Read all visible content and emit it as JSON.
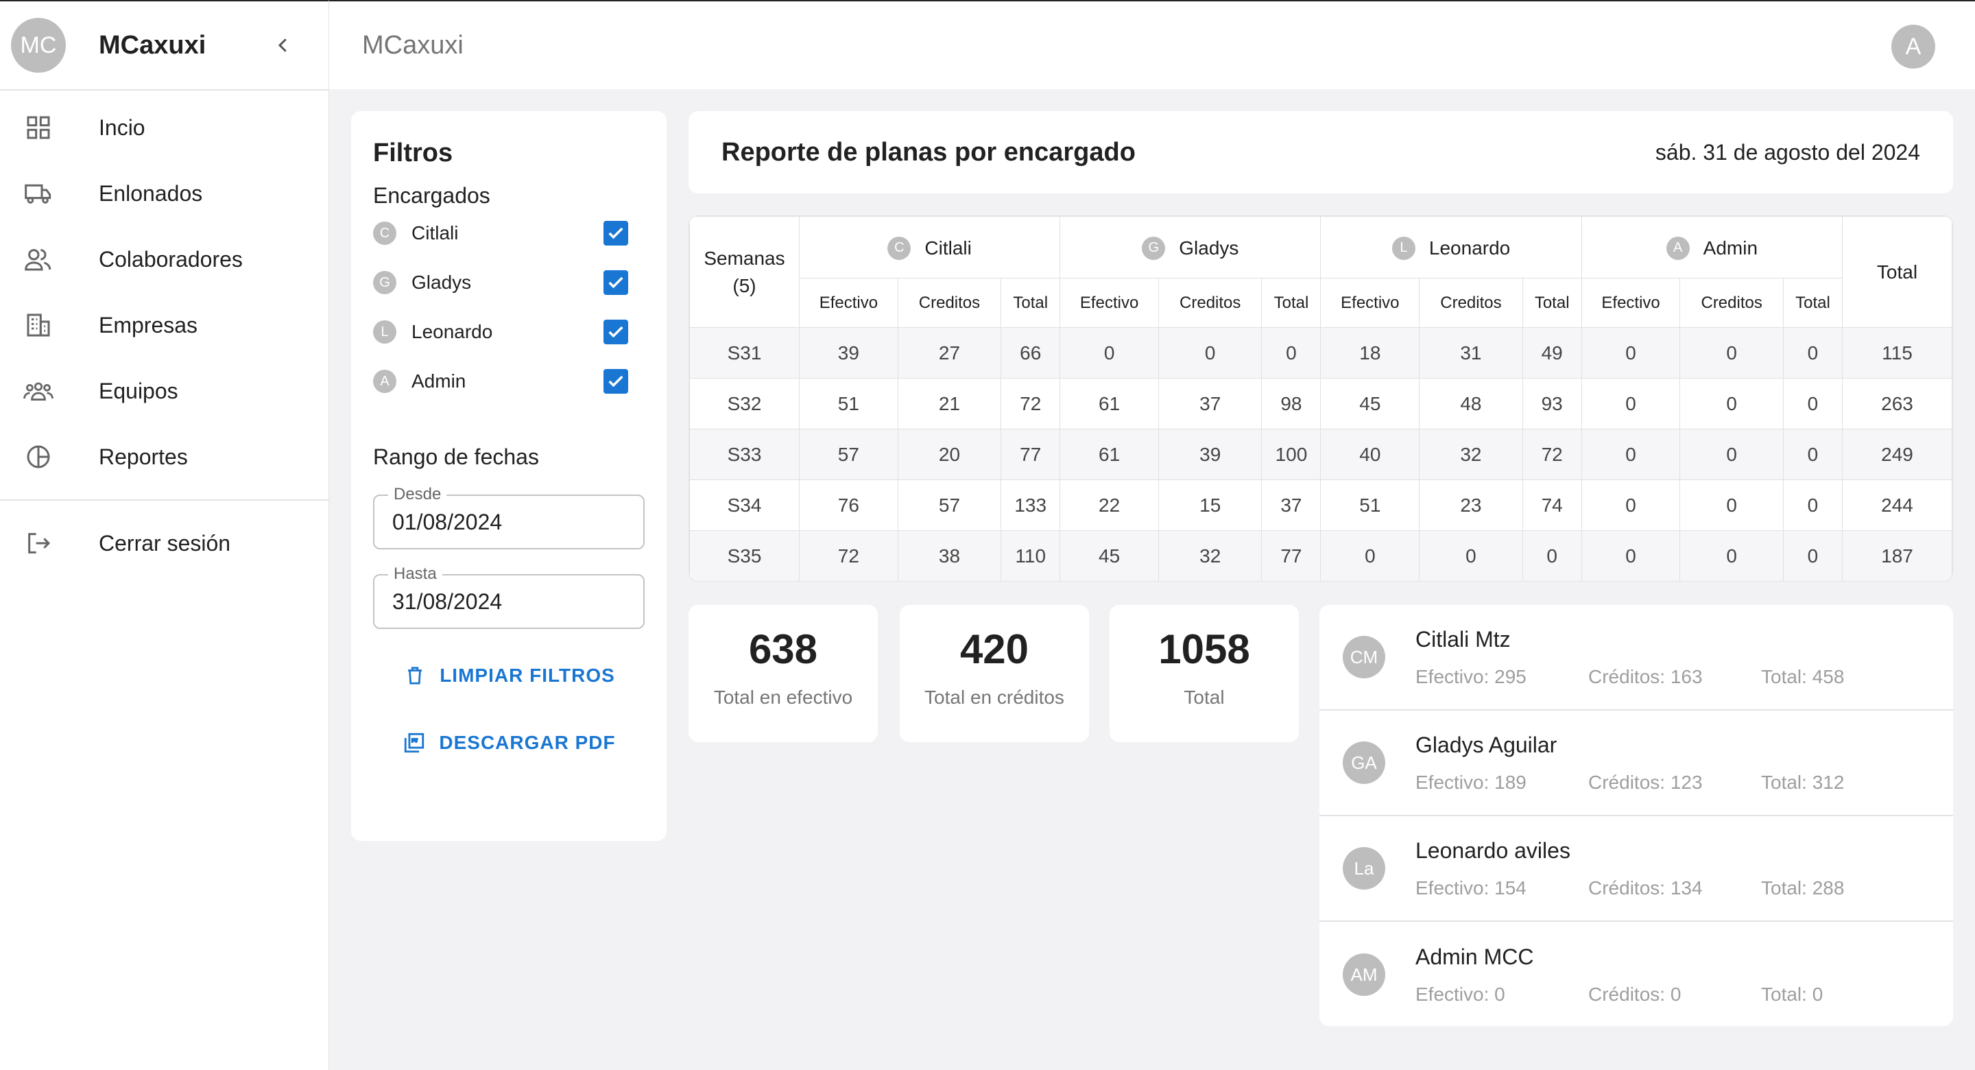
{
  "sidebar": {
    "avatar": "MC",
    "title": "MCaxuxi",
    "items": [
      {
        "label": "Incio",
        "icon": "dashboard-icon"
      },
      {
        "label": "Enlonados",
        "icon": "truck-icon"
      },
      {
        "label": "Colaboradores",
        "icon": "people-icon"
      },
      {
        "label": "Empresas",
        "icon": "building-icon"
      },
      {
        "label": "Equipos",
        "icon": "groups-icon"
      },
      {
        "label": "Reportes",
        "icon": "pie-chart-icon"
      }
    ],
    "logout": "Cerrar sesión"
  },
  "topbar": {
    "title": "MCaxuxi",
    "avatar": "A"
  },
  "filters": {
    "title": "Filtros",
    "encargados_label": "Encargados",
    "encargados": [
      {
        "initial": "C",
        "name": "Citlali",
        "checked": true
      },
      {
        "initial": "G",
        "name": "Gladys",
        "checked": true
      },
      {
        "initial": "L",
        "name": "Leonardo",
        "checked": true
      },
      {
        "initial": "A",
        "name": "Admin",
        "checked": true
      }
    ],
    "range_label": "Rango de fechas",
    "desde_label": "Desde",
    "desde_value": "01/08/2024",
    "hasta_label": "Hasta",
    "hasta_value": "31/08/2024",
    "clear_label": "LIMPIAR FILTROS",
    "pdf_label": "DESCARGAR PDF",
    "accent": "#1976d2"
  },
  "report": {
    "title": "Reporte de planas por encargado",
    "date": "sáb. 31 de agosto del 2024"
  },
  "table": {
    "weeks_header": "Semanas",
    "weeks_count": "(5)",
    "total_header": "Total",
    "groups": [
      {
        "initial": "C",
        "name": "Citlali"
      },
      {
        "initial": "G",
        "name": "Gladys"
      },
      {
        "initial": "L",
        "name": "Leonardo"
      },
      {
        "initial": "A",
        "name": "Admin"
      }
    ],
    "sub_headers": [
      "Efectivo",
      "Creditos",
      "Total"
    ],
    "rows": [
      {
        "week": "S31",
        "vals": [
          "39",
          "27",
          "66",
          "0",
          "0",
          "0",
          "18",
          "31",
          "49",
          "0",
          "0",
          "0"
        ],
        "total": "115"
      },
      {
        "week": "S32",
        "vals": [
          "51",
          "21",
          "72",
          "61",
          "37",
          "98",
          "45",
          "48",
          "93",
          "0",
          "0",
          "0"
        ],
        "total": "263"
      },
      {
        "week": "S33",
        "vals": [
          "57",
          "20",
          "77",
          "61",
          "39",
          "100",
          "40",
          "32",
          "72",
          "0",
          "0",
          "0"
        ],
        "total": "249"
      },
      {
        "week": "S34",
        "vals": [
          "76",
          "57",
          "133",
          "22",
          "15",
          "37",
          "51",
          "23",
          "74",
          "0",
          "0",
          "0"
        ],
        "total": "244"
      },
      {
        "week": "S35",
        "vals": [
          "72",
          "38",
          "110",
          "45",
          "32",
          "77",
          "0",
          "0",
          "0",
          "0",
          "0",
          "0"
        ],
        "total": "187"
      }
    ]
  },
  "stats": [
    {
      "value": "638",
      "label": "Total en efectivo"
    },
    {
      "value": "420",
      "label": "Total en créditos"
    },
    {
      "value": "1058",
      "label": "Total"
    }
  ],
  "persons": [
    {
      "avatar": "CM",
      "name": "Citlali Mtz",
      "efectivo": "Efectivo: 295",
      "creditos": "Créditos: 163",
      "total": "Total: 458"
    },
    {
      "avatar": "GA",
      "name": "Gladys Aguilar",
      "efectivo": "Efectivo: 189",
      "creditos": "Créditos: 123",
      "total": "Total: 312"
    },
    {
      "avatar": "La",
      "name": "Leonardo aviles",
      "efectivo": "Efectivo: 154",
      "creditos": "Créditos: 134",
      "total": "Total: 288"
    },
    {
      "avatar": "AM",
      "name": "Admin MCC",
      "efectivo": "Efectivo: 0",
      "creditos": "Créditos: 0",
      "total": "Total: 0"
    }
  ]
}
